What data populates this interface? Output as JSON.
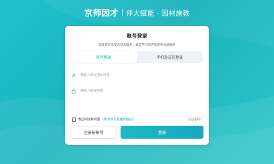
{
  "header": {
    "logo_text": "京师因才",
    "slogan": "师大赋能 · 因材施教"
  },
  "login": {
    "title": "账号登录",
    "subtitle": "登录即可享受包括云服务，确定学习机内的所有优质服务",
    "tabs": [
      {
        "label": "账号登录",
        "active": true
      },
      {
        "label": "手机验证码登录",
        "active": false
      }
    ],
    "username_placeholder": "请输入师大因才账号",
    "password_placeholder": "请输入账号密码",
    "agree_text": "我已阅读并同意",
    "agree_link": "《软件许可及服务协议》",
    "forgot_label": "忘记密码?",
    "register_label": "注册新账号",
    "login_label": "登录"
  },
  "colors": {
    "accent": "#1ab0bd",
    "background": "#1fc2cc",
    "link": "#1a9fd0"
  }
}
